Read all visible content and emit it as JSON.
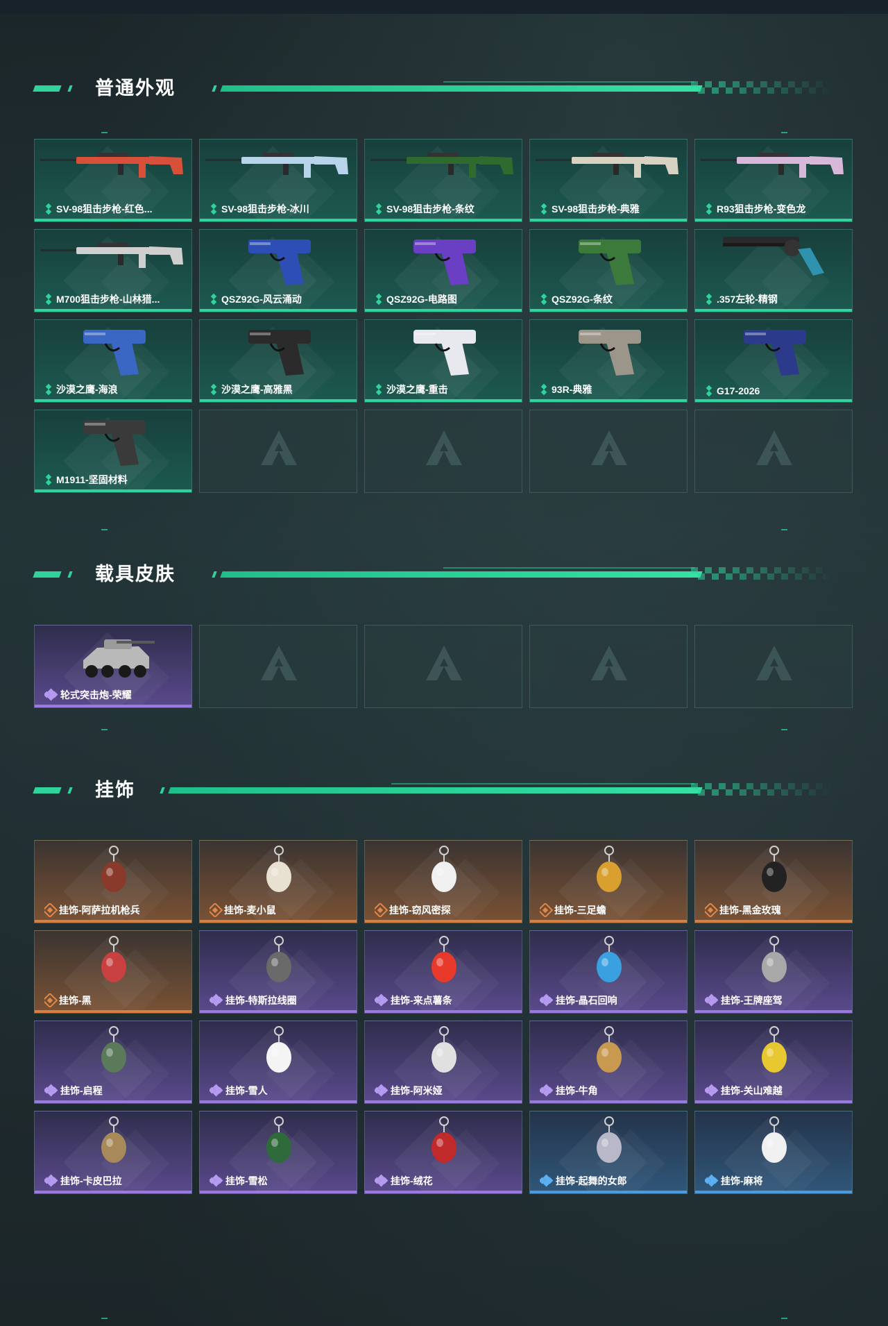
{
  "sections": [
    {
      "id": "weapons",
      "title": "普通外观",
      "items": [
        {
          "label": "SV-98狙击步枪-红色...",
          "rarity": "green",
          "art": "rifle",
          "color": "#d9503a"
        },
        {
          "label": "SV-98狙击步枪-冰川",
          "rarity": "green",
          "art": "rifle",
          "color": "#b8d4ea"
        },
        {
          "label": "SV-98狙击步枪-条纹",
          "rarity": "green",
          "art": "rifle",
          "color": "#2f6b2f"
        },
        {
          "label": "SV-98狙击步枪-典雅",
          "rarity": "green",
          "art": "rifle",
          "color": "#d8d2c2"
        },
        {
          "label": "R93狙击步枪-变色龙",
          "rarity": "green",
          "art": "rifle",
          "color": "#d7b8d8"
        },
        {
          "label": "M700狙击步枪-山林猎...",
          "rarity": "green",
          "art": "rifle",
          "color": "#cfcfcf"
        },
        {
          "label": "QSZ92G-风云涌动",
          "rarity": "green",
          "art": "pistol",
          "color": "#2d4fb5"
        },
        {
          "label": "QSZ92G-电路图",
          "rarity": "green",
          "art": "pistol",
          "color": "#6a3fc4"
        },
        {
          "label": "QSZ92G-条纹",
          "rarity": "green",
          "art": "pistol",
          "color": "#3b7a3b"
        },
        {
          "label": ".357左轮-精钢",
          "rarity": "green",
          "art": "revolver",
          "color": "#2f93b0"
        },
        {
          "label": "沙漠之鹰-海浪",
          "rarity": "green",
          "art": "pistol",
          "color": "#3a66c4"
        },
        {
          "label": "沙漠之鹰-高雅黑",
          "rarity": "green",
          "art": "pistol",
          "color": "#2b2b2b"
        },
        {
          "label": "沙漠之鹰-重击",
          "rarity": "green",
          "art": "pistol",
          "color": "#e8e8ef"
        },
        {
          "label": "93R-典雅",
          "rarity": "green",
          "art": "pistol",
          "color": "#9c958a"
        },
        {
          "label": "G17-2026",
          "rarity": "green",
          "art": "pistol",
          "color": "#2b3a8a"
        },
        {
          "label": "M1911-坚固材料",
          "rarity": "green",
          "art": "pistol",
          "color": "#3a3a3a"
        }
      ],
      "empty_slots": 4
    },
    {
      "id": "vehicles",
      "title": "载具皮肤",
      "items": [
        {
          "label": "轮式突击炮-荣耀",
          "rarity": "purple",
          "art": "vehicle",
          "color": "#b9b9b9"
        }
      ],
      "empty_slots": 4
    },
    {
      "id": "charms",
      "title": "挂饰",
      "items": [
        {
          "label": "挂饰-阿萨拉机枪兵",
          "rarity": "orange",
          "art": "charm",
          "color": "#8a3a2a"
        },
        {
          "label": "挂饰-麦小鼠",
          "rarity": "orange",
          "art": "charm",
          "color": "#e8e0d0"
        },
        {
          "label": "挂饰-窃风密探",
          "rarity": "orange",
          "art": "charm",
          "color": "#f0f0f0"
        },
        {
          "label": "挂饰-三足蟾",
          "rarity": "orange",
          "art": "charm",
          "color": "#d9a030"
        },
        {
          "label": "挂饰-黑金玫瑰",
          "rarity": "orange",
          "art": "charm",
          "color": "#222222"
        },
        {
          "label": "挂饰-黑",
          "rarity": "orange",
          "art": "charm",
          "color": "#c84040"
        },
        {
          "label": "挂饰-特斯拉线圈",
          "rarity": "purple",
          "art": "charm",
          "color": "#6a6a6a"
        },
        {
          "label": "挂饰-来点薯条",
          "rarity": "purple",
          "art": "charm",
          "color": "#e83a2a"
        },
        {
          "label": "挂饰-晶石回响",
          "rarity": "purple",
          "art": "charm",
          "color": "#3aa0e0"
        },
        {
          "label": "挂饰-王牌座驾",
          "rarity": "purple",
          "art": "charm",
          "color": "#a8a8a8"
        },
        {
          "label": "挂饰-启程",
          "rarity": "purple",
          "art": "charm",
          "color": "#5a7a5a"
        },
        {
          "label": "挂饰-雪人",
          "rarity": "purple",
          "art": "charm",
          "color": "#f4f4f4"
        },
        {
          "label": "挂饰-阿米娅",
          "rarity": "purple",
          "art": "charm",
          "color": "#e0e0e0"
        },
        {
          "label": "挂饰-牛角",
          "rarity": "purple",
          "art": "charm",
          "color": "#c89a50"
        },
        {
          "label": "挂饰-关山难越",
          "rarity": "purple",
          "art": "charm",
          "color": "#e8c830"
        },
        {
          "label": "挂饰-卡皮巴拉",
          "rarity": "purple",
          "art": "charm",
          "color": "#a88a5a"
        },
        {
          "label": "挂饰-雪松",
          "rarity": "purple",
          "art": "charm",
          "color": "#2f6a3a"
        },
        {
          "label": "挂饰-绒花",
          "rarity": "purple",
          "art": "charm",
          "color": "#c02a2a"
        },
        {
          "label": "挂饰-起舞的女郎",
          "rarity": "blue",
          "art": "charm",
          "color": "#b8b8c8"
        },
        {
          "label": "挂饰-麻将",
          "rarity": "blue",
          "art": "charm",
          "color": "#f0f0f0"
        }
      ],
      "empty_slots": 0
    }
  ],
  "theme": {
    "accent": "#2fd39b",
    "green_rarity": "#2fd39b",
    "purple_rarity": "#9a7ae0",
    "orange_rarity": "#d77f3e",
    "blue_rarity": "#4a9be0"
  }
}
